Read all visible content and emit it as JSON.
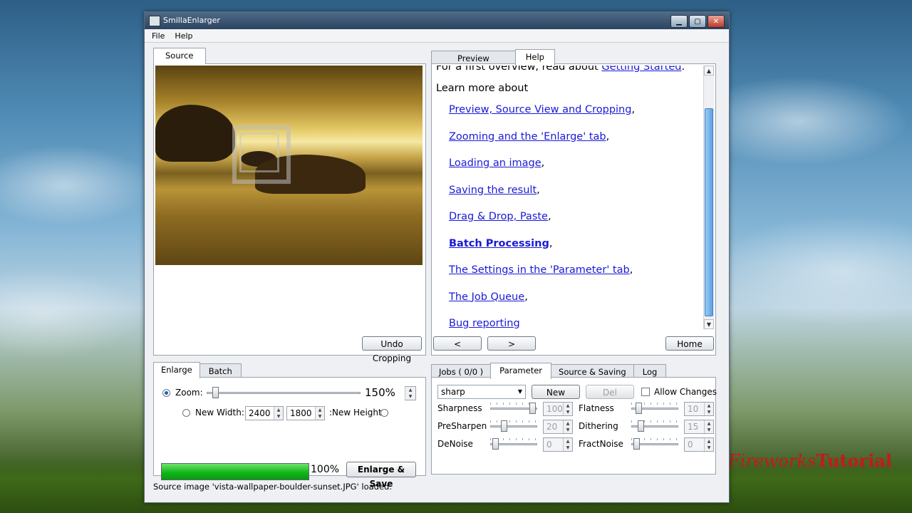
{
  "window": {
    "title": "SmillaEnlarger",
    "menu": [
      "File",
      "Help"
    ]
  },
  "source_panel": {
    "tab": "Source",
    "undo_button": "Undo Cropping"
  },
  "help_panel": {
    "tabs": [
      "Preview",
      "Help"
    ],
    "active_tab": "Help",
    "intro_prefix": "For a first overview, read about ",
    "intro_link": "Getting Started",
    "intro_suffix": ".",
    "learn_more": "Learn more about",
    "links": [
      "Preview, Source View and Cropping",
      "Zooming and the 'Enlarge' tab",
      "Loading an image",
      "Saving the result",
      "Drag & Drop, Paste",
      "Batch Processing",
      "The Settings in the 'Parameter' tab",
      "The Job Queue",
      "Bug reporting"
    ],
    "separator": ",",
    "back_button": "<",
    "forward_button": ">",
    "home_button": "Home"
  },
  "enlarge_panel": {
    "tabs": [
      "Enlarge",
      "Batch"
    ],
    "zoom_label": "Zoom:",
    "zoom_value": "150%",
    "new_width_label": "New Width:",
    "width_value": "2400",
    "height_value": "1800",
    "new_height_label": ":New Height",
    "progress": 1.0,
    "progress_text": "100%",
    "enlarge_button": "Enlarge & Save"
  },
  "parameter_panel": {
    "tabs": [
      "Jobs ( 0/0 )",
      "Parameter",
      "Source & Saving",
      "Log"
    ],
    "preset": "sharp",
    "new_button": "New",
    "del_button": "Del",
    "allow_changes": "Allow Changes",
    "params": [
      {
        "name": "Sharpness",
        "value": "100"
      },
      {
        "name": "Flatness",
        "value": "10"
      },
      {
        "name": "PreSharpen",
        "value": "20"
      },
      {
        "name": "Dithering",
        "value": "15"
      },
      {
        "name": "DeNoise",
        "value": "0"
      },
      {
        "name": "FractNoise",
        "value": "0"
      }
    ]
  },
  "status_bar": {
    "text": "Source image 'vista-wallpaper-boulder-sunset.JPG' loaded."
  },
  "watermark": {
    "part1": "Fireworks",
    "part2": "Tutorial"
  },
  "colors": {
    "link": "#1a1ad6",
    "progress_green": "#10b71a",
    "titlebar": "#2c4460"
  }
}
